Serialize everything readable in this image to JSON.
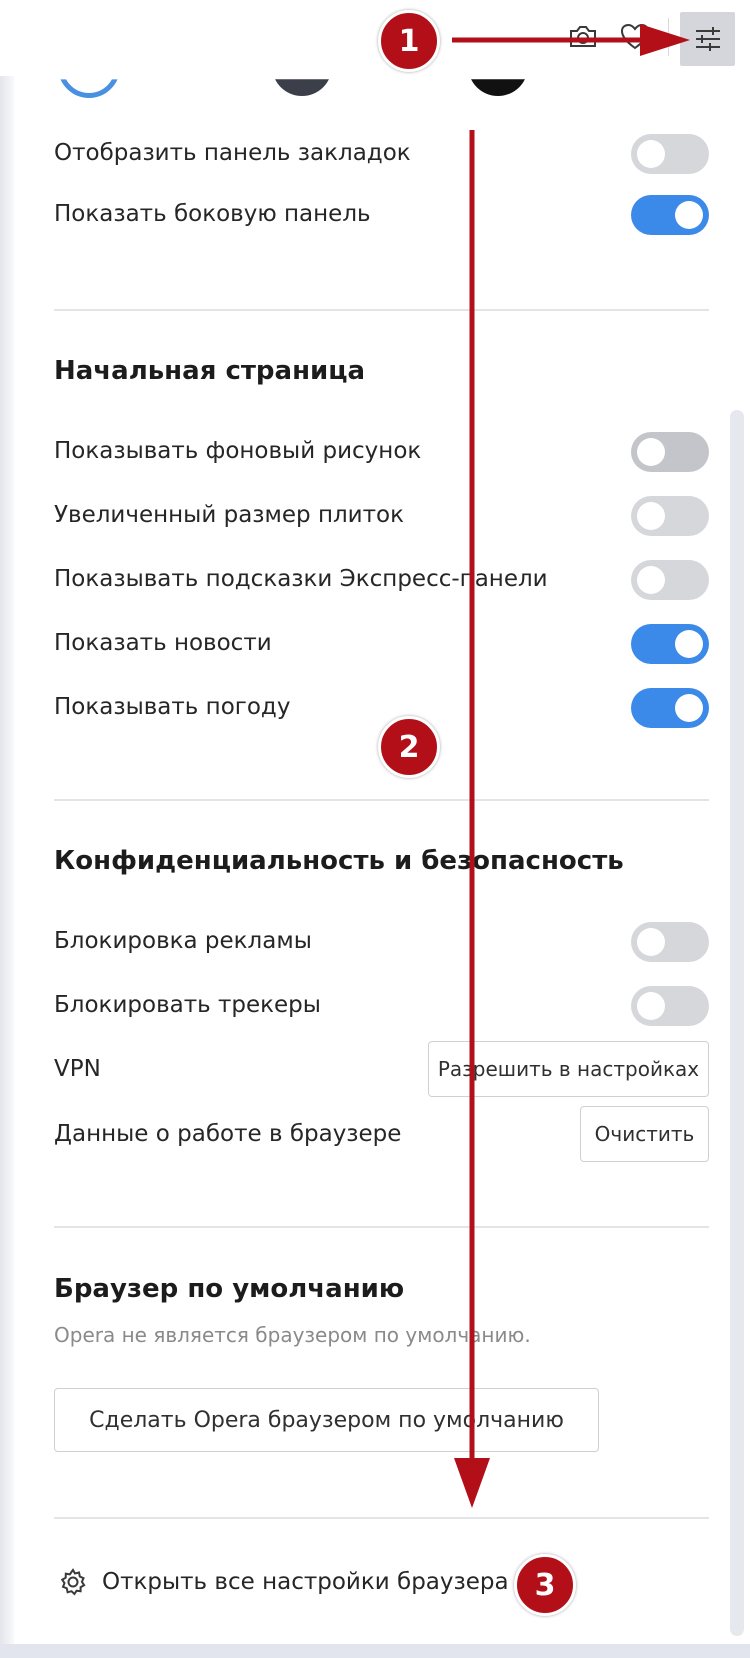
{
  "toolbar": {
    "camera_icon": "camera-icon",
    "heart_icon": "heart-icon",
    "settings_icon": "easy-setup-icon"
  },
  "appearance_rows": [
    {
      "label": "Отобразить панель закладок",
      "on": false
    },
    {
      "label": "Показать боковую панель",
      "on": true
    }
  ],
  "start_page": {
    "title": "Начальная страница",
    "rows": [
      {
        "label": "Показывать фоновый рисунок",
        "on": false
      },
      {
        "label": "Увеличенный размер плиток",
        "on": false
      },
      {
        "label": "Показывать подсказки Экспресс-панели",
        "on": false
      },
      {
        "label": "Показать новости",
        "on": true
      },
      {
        "label": "Показывать погоду",
        "on": true
      }
    ]
  },
  "privacy": {
    "title": "Конфиденциальность и безопасность",
    "rows": [
      {
        "label": "Блокировка рекламы",
        "on": false
      },
      {
        "label": "Блокировать трекеры",
        "on": false
      }
    ],
    "vpn_label": "VPN",
    "vpn_button": "Разрешить в настройках",
    "data_label": "Данные о работе в браузере",
    "data_button": "Очистить"
  },
  "default_browser": {
    "title": "Браузер по умолчанию",
    "note": "Opera не является браузером по умолчанию.",
    "button": "Сделать Opera браузером по умолчанию"
  },
  "footer": {
    "link": "Открыть все настройки браузера",
    "icon": "gear-icon"
  },
  "annotations": {
    "step1": "1",
    "step2": "2",
    "step3": "3",
    "color": "#b20f18"
  },
  "colors": {
    "toggle_on": "#3b8ae9",
    "toggle_off": "#d6d7da"
  }
}
